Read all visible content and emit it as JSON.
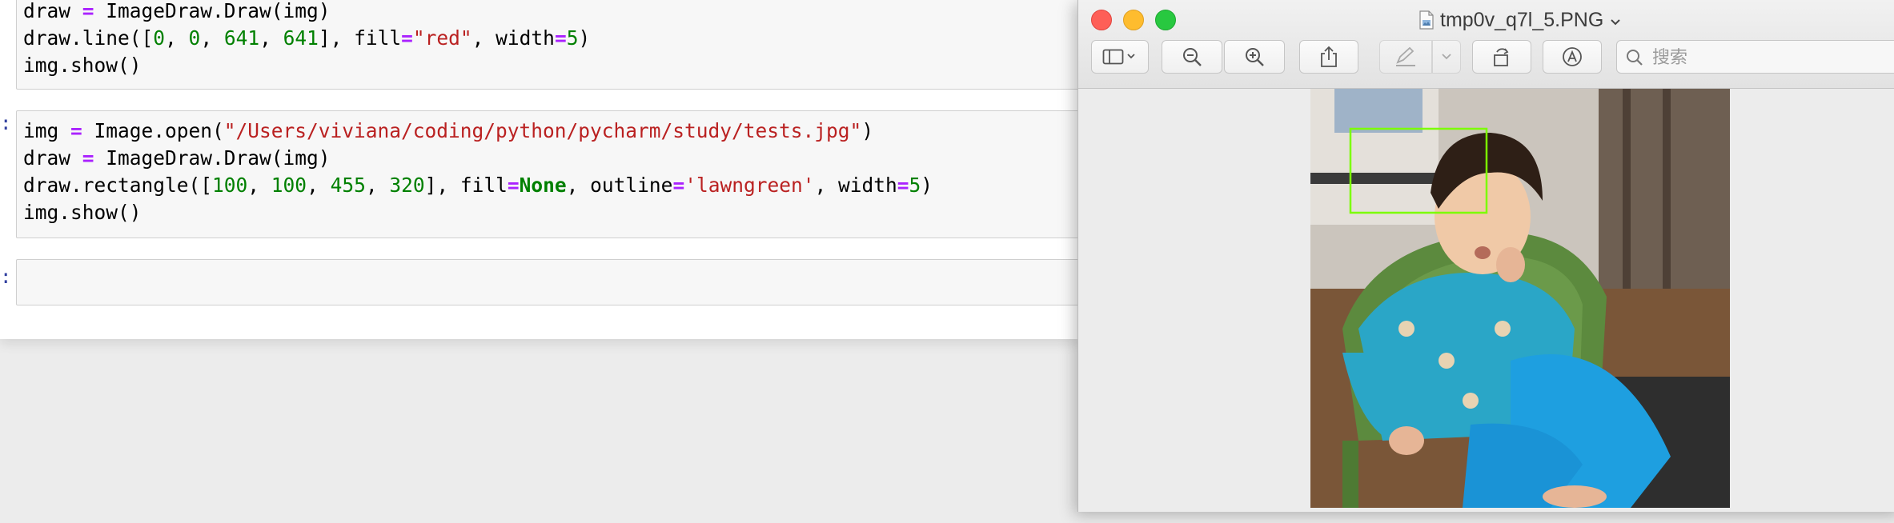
{
  "notebook": {
    "cell1": {
      "prompt_mark": "",
      "lines": [
        "draw = ImageDraw.Draw(img)",
        "draw.line([0, 0, 641, 641], fill=\"red\", width=5)",
        "img.show()"
      ]
    },
    "cell2": {
      "prompt_mark": ":",
      "lines": [
        "img = Image.open(\"/Users/viviana/coding/python/pycharm/study/tests.jpg\")",
        "draw = ImageDraw.Draw(img)",
        "draw.rectangle([100, 100, 455, 320], fill=None, outline='lawngreen', width=5)",
        "img.show()"
      ]
    },
    "cell3": {
      "prompt_mark": ":",
      "value": ""
    }
  },
  "preview": {
    "title": "tmp0v_q7l_5.PNG",
    "title_chevron": "⌄",
    "toolbar": {
      "sidebar_icon": "sidebar-icon",
      "zoom_out_icon": "zoom-out-icon",
      "zoom_in_icon": "zoom-in-icon",
      "share_icon": "share-icon",
      "markup_icon": "markup-pen-icon",
      "rotate_icon": "rotate-icon",
      "annotate_icon": "annotate-icon"
    },
    "search": {
      "placeholder": "搜索",
      "value": ""
    },
    "image": {
      "description_icon": "photo-image",
      "highlight_outline_color": "#7cfc00"
    }
  },
  "colors": {
    "close": "#fe5f57",
    "minimize": "#febc2e",
    "maximize": "#28c840",
    "string": "#ba2121",
    "number": "#008000",
    "operator": "#aa22ff",
    "rectangle_outline": "#7cfc00"
  }
}
